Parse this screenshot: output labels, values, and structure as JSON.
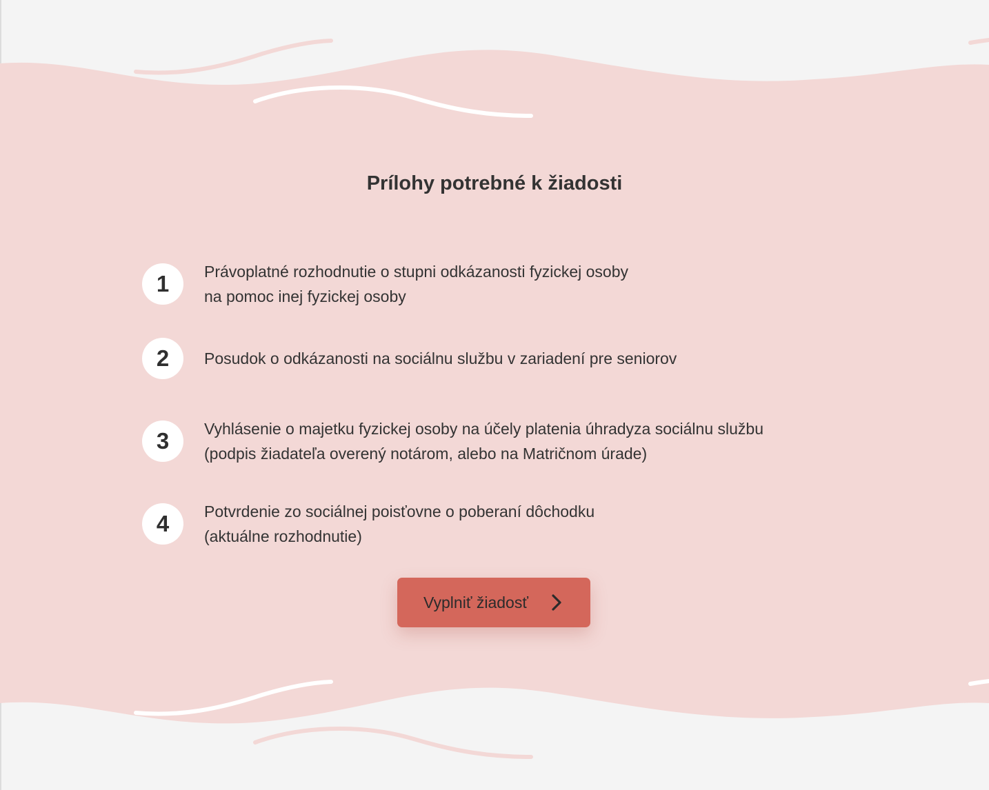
{
  "section": {
    "title": "Prílohy potrebné k žiadosti"
  },
  "attachments": [
    {
      "number": "1",
      "line1": "Právoplatné rozhodnutie o stupni odkázanosti fyzickej osoby",
      "line2": "na pomoc inej fyzickej osoby"
    },
    {
      "number": "2",
      "line1": "Posudok o odkázanosti na sociálnu službu v zariadení pre seniorov",
      "line2": ""
    },
    {
      "number": "3",
      "line1": "Vyhlásenie o majetku fyzickej osoby na účely platenia úhradyza sociálnu službu",
      "line2": "(podpis žiadateľa overený notárom, alebo na Matričnom úrade)"
    },
    {
      "number": "4",
      "line1": "Potvrdenie zo sociálnej poisťovne o poberaní dôchodku",
      "line2": "(aktuálne rozhodnutie)"
    }
  ],
  "cta": {
    "label": "Vyplniť žiadosť",
    "icon": "chevron-right-icon"
  },
  "colors": {
    "page_background": "#f4f4f4",
    "band": "#f3d8d6",
    "button": "#d4675b",
    "text": "#333333",
    "badge": "#ffffff",
    "top_decor_lines": "#f3d8d6",
    "bottom_decor_lines": "#f3d8d6"
  }
}
